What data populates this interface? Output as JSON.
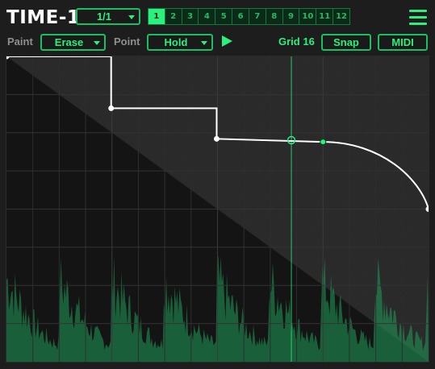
{
  "header": {
    "title": "TIME-1",
    "rate_select": "1/1",
    "patterns": [
      "1",
      "2",
      "3",
      "4",
      "5",
      "6",
      "7",
      "8",
      "9",
      "10",
      "11",
      "12"
    ],
    "active_pattern": "1",
    "menu_icon": "hamburger-menu-icon"
  },
  "toolbar": {
    "paint_label": "Paint",
    "paint_value": "Erase",
    "point_label": "Point",
    "point_value": "Hold",
    "play_icon": "play-icon",
    "grid_label": "Grid 16",
    "snap_label": "Snap",
    "midi_label": "MIDI"
  },
  "colors": {
    "accent": "#2af07d",
    "accent_border": "#17c163",
    "background": "#1d1d1d",
    "editor_bg": "#141414",
    "curve": "#ffffff",
    "waveform": "#1e9e5a"
  },
  "envelope": {
    "x_range": [
      0,
      1
    ],
    "y_range": [
      0,
      1
    ],
    "grid_columns": 16,
    "grid_rows": 8,
    "playhead_position": 0.675,
    "points": [
      {
        "x": 0.0,
        "y": 1.0,
        "mode": "hold"
      },
      {
        "x": 0.248,
        "y": 0.83,
        "mode": "hold"
      },
      {
        "x": 0.498,
        "y": 0.73,
        "mode": "curve"
      },
      {
        "x": 0.75,
        "y": 0.72,
        "mode": "curve"
      },
      {
        "x": 1.0,
        "y": 0.5,
        "mode": "curve"
      }
    ]
  }
}
